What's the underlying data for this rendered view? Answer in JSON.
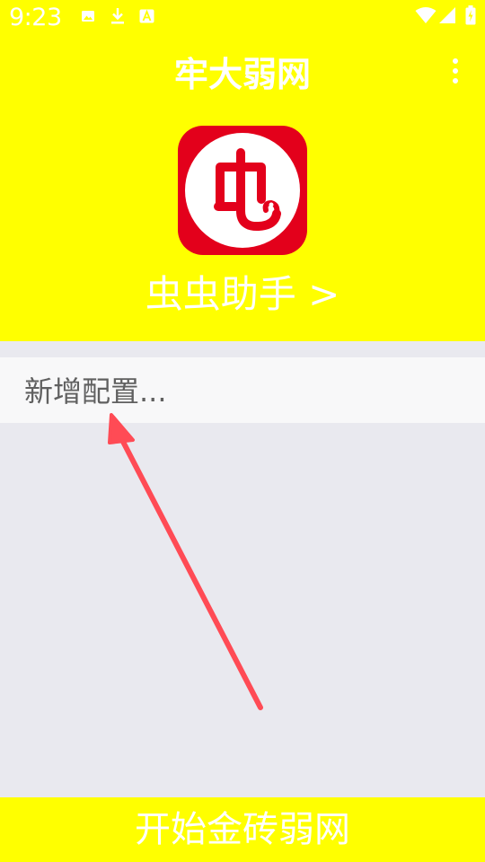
{
  "status_bar": {
    "time": "9:23",
    "left_icons": [
      "image-icon",
      "download-icon",
      "font-icon"
    ],
    "right_icons": [
      "wifi-icon",
      "signal-icon",
      "battery-icon"
    ]
  },
  "header": {
    "title": "牢大弱网",
    "menu_icon": "more-vert-icon",
    "background_color": "#ffff00"
  },
  "app": {
    "logo_icon": "bug-logo-icon",
    "logo_color": "#e3001b",
    "link_label": "虫虫助手 >"
  },
  "config": {
    "add_label": "新增配置..."
  },
  "annotation": {
    "arrow_color": "#ff4b55"
  },
  "footer": {
    "start_label": "开始金砖弱网"
  }
}
